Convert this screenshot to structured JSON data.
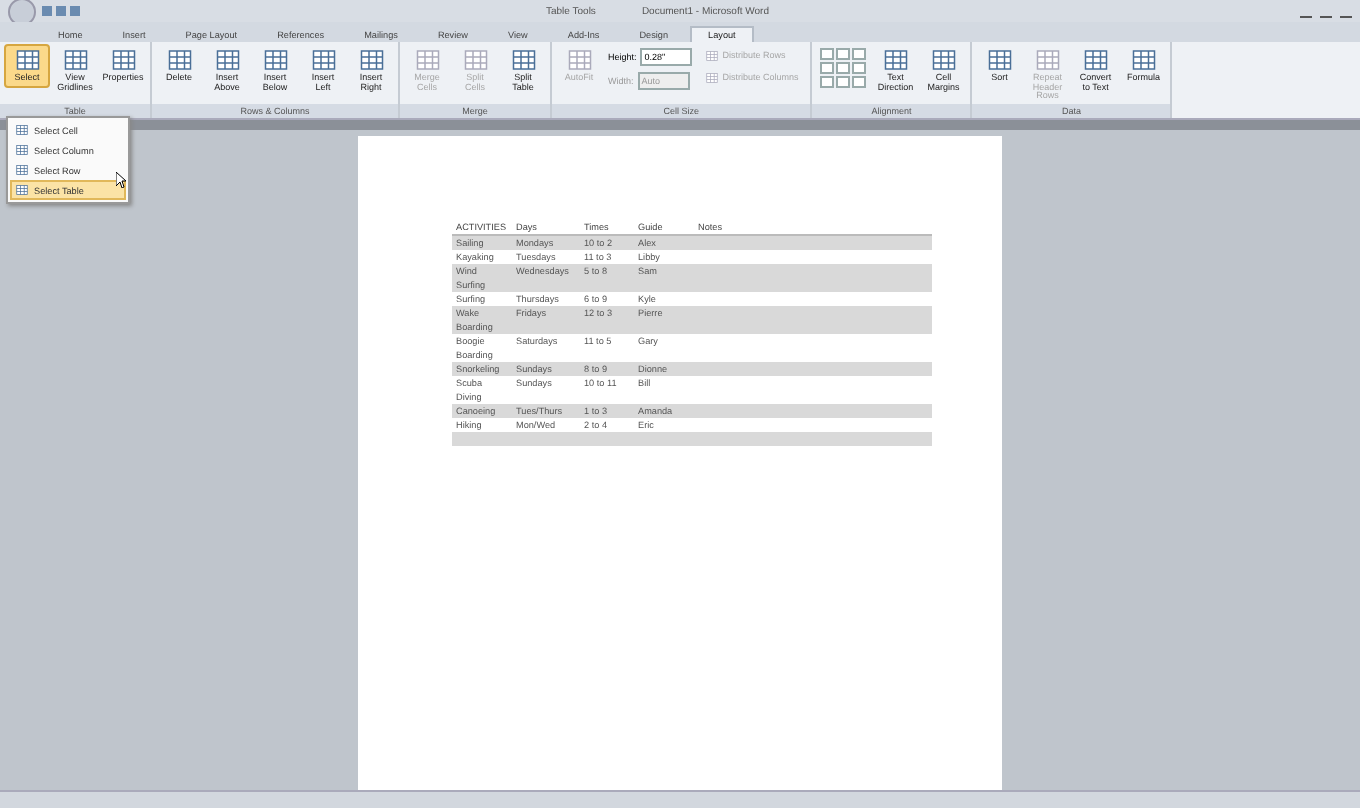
{
  "window": {
    "context_title": "Table Tools",
    "title": "Document1 - Microsoft Word"
  },
  "ribbon_tabs": [
    {
      "label": "Home",
      "selected": false
    },
    {
      "label": "Insert",
      "selected": false
    },
    {
      "label": "Page Layout",
      "selected": false
    },
    {
      "label": "References",
      "selected": false
    },
    {
      "label": "Mailings",
      "selected": false
    },
    {
      "label": "Review",
      "selected": false
    },
    {
      "label": "View",
      "selected": false
    },
    {
      "label": "Add-Ins",
      "selected": false
    },
    {
      "label": "Design",
      "selected": false
    },
    {
      "label": "Layout",
      "selected": true
    }
  ],
  "ribbon_groups": [
    {
      "label": "Table",
      "items": [
        {
          "kind": "large",
          "label": "Select",
          "disabled": false,
          "pressed": true
        },
        {
          "kind": "large",
          "label": "View Gridlines",
          "disabled": false,
          "pressed": false
        },
        {
          "kind": "large",
          "label": "Properties",
          "disabled": false,
          "pressed": false
        }
      ]
    },
    {
      "label": "Rows & Columns",
      "items": [
        {
          "kind": "large",
          "label": "Delete",
          "disabled": false,
          "pressed": false
        },
        {
          "kind": "large",
          "label": "Insert Above",
          "disabled": false,
          "pressed": false
        },
        {
          "kind": "large",
          "label": "Insert Below",
          "disabled": false,
          "pressed": false
        },
        {
          "kind": "large",
          "label": "Insert Left",
          "disabled": false,
          "pressed": false
        },
        {
          "kind": "large",
          "label": "Insert Right",
          "disabled": false,
          "pressed": false
        }
      ]
    },
    {
      "label": "Merge",
      "items": [
        {
          "kind": "large",
          "label": "Merge Cells",
          "disabled": true,
          "pressed": false
        },
        {
          "kind": "large",
          "label": "Split Cells",
          "disabled": true,
          "pressed": false
        },
        {
          "kind": "large",
          "label": "Split Table",
          "disabled": false,
          "pressed": false
        }
      ]
    },
    {
      "label": "Cell Size",
      "items": [
        {
          "kind": "large",
          "label": "AutoFit",
          "disabled": true,
          "pressed": false
        },
        {
          "kind": "field",
          "label": "Height:",
          "value": "0.28\"",
          "disabled": false
        },
        {
          "kind": "field",
          "label": "Width:",
          "value": "Auto",
          "disabled": true
        },
        {
          "kind": "small",
          "label": "Distribute Rows",
          "disabled": true,
          "pressed": false
        },
        {
          "kind": "small",
          "label": "Distribute Columns",
          "disabled": true,
          "pressed": false
        }
      ]
    },
    {
      "label": "Alignment",
      "items": [
        {
          "kind": "align-grid"
        },
        {
          "kind": "large",
          "label": "Text Direction",
          "disabled": false,
          "pressed": false
        },
        {
          "kind": "large",
          "label": "Cell Margins",
          "disabled": false,
          "pressed": false
        }
      ]
    },
    {
      "label": "Data",
      "items": [
        {
          "kind": "large",
          "label": "Sort",
          "disabled": false,
          "pressed": false
        },
        {
          "kind": "large",
          "label": "Repeat Header Rows",
          "disabled": true,
          "pressed": false
        },
        {
          "kind": "large",
          "label": "Convert to Text",
          "disabled": false,
          "pressed": false
        },
        {
          "kind": "large",
          "label": "Formula",
          "disabled": false,
          "pressed": false
        }
      ]
    }
  ],
  "select_menu": [
    {
      "label": "Select Cell",
      "hovered": false
    },
    {
      "label": "Select Column",
      "hovered": false
    },
    {
      "label": "Select Row",
      "hovered": false
    },
    {
      "label": "Select Table",
      "hovered": true
    }
  ],
  "table": {
    "columns": [
      "ACTIVITIES",
      "Days",
      "Times",
      "Guide",
      "Notes"
    ],
    "rows": [
      {
        "cells": [
          "Sailing",
          "Mondays",
          "10 to 2",
          "Alex",
          ""
        ],
        "shaded": true
      },
      {
        "cells": [
          "Kayaking",
          "Tuesdays",
          "11 to 3",
          "Libby",
          ""
        ],
        "shaded": false
      },
      {
        "cells": [
          "Wind Surfing",
          "Wednesdays",
          "5 to 8",
          "Sam",
          ""
        ],
        "shaded": true
      },
      {
        "cells": [
          "Surfing",
          "Thursdays",
          "6 to 9",
          "Kyle",
          ""
        ],
        "shaded": false
      },
      {
        "cells": [
          "Wake Boarding",
          "Fridays",
          "12 to 3",
          "Pierre",
          ""
        ],
        "shaded": true
      },
      {
        "cells": [
          "Boogie Boarding",
          "Saturdays",
          "11 to 5",
          "Gary",
          ""
        ],
        "shaded": false
      },
      {
        "cells": [
          "Snorkeling",
          "Sundays",
          "8 to 9",
          "Dionne",
          ""
        ],
        "shaded": true
      },
      {
        "cells": [
          "Scuba Diving",
          "Sundays",
          "10 to 11",
          "Bill",
          ""
        ],
        "shaded": false
      },
      {
        "cells": [
          "Canoeing",
          "Tues/Thurs",
          "1 to 3",
          "Amanda",
          ""
        ],
        "shaded": true
      },
      {
        "cells": [
          "Hiking",
          "Mon/Wed",
          "2 to 4",
          "Eric",
          ""
        ],
        "shaded": false
      },
      {
        "cells": [
          "",
          "",
          "",
          "",
          ""
        ],
        "shaded": true
      }
    ]
  }
}
